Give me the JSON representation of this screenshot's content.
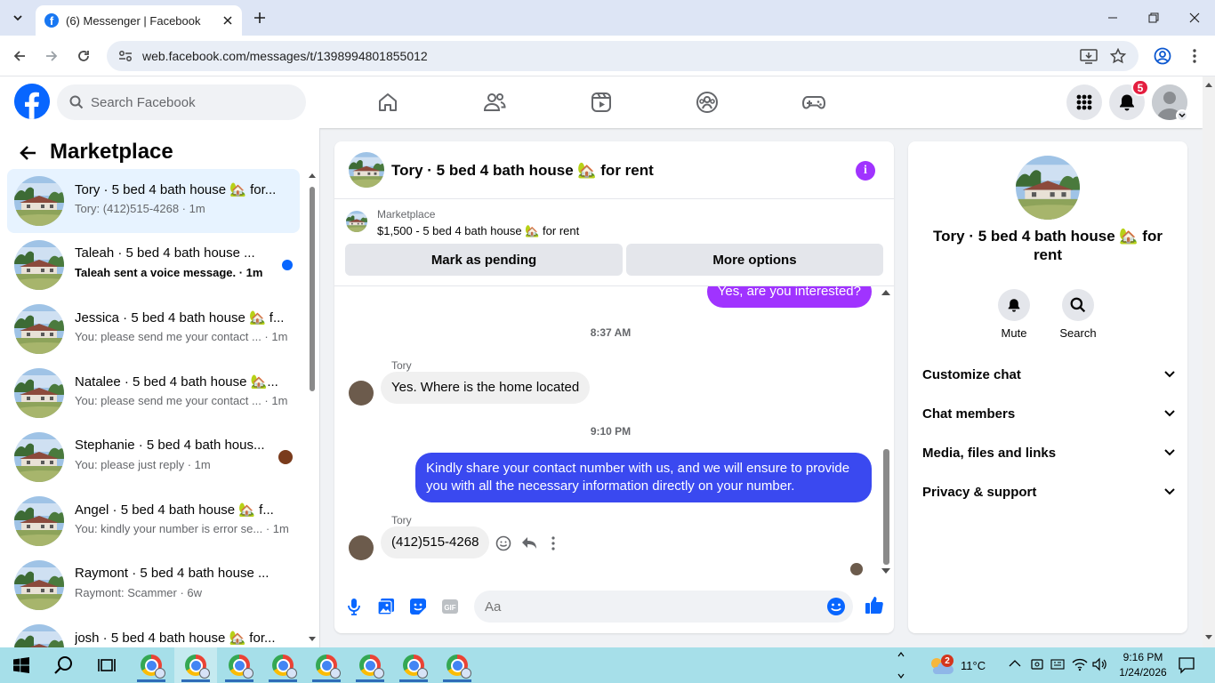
{
  "browser": {
    "tab_title": "(6) Messenger | Facebook",
    "url": "web.facebook.com/messages/t/1398994801855012"
  },
  "facebook": {
    "search_placeholder": "Search Facebook",
    "notification_count": "5",
    "brand_color": "#0866ff"
  },
  "left_panel": {
    "title": "Marketplace",
    "conversations": [
      {
        "name": "Tory · 5 bed 4 bath house 🏡 for...",
        "preview": "Tory: (412)515-4268 · 1m",
        "active": true
      },
      {
        "name": "Taleah · 5 bed 4 bath house ...",
        "preview": "Taleah sent a voice message. · 1m",
        "unread": true
      },
      {
        "name": "Jessica · 5 bed 4 bath house 🏡 f...",
        "preview": "You: please send me your contact ... · 1m"
      },
      {
        "name": "Natalee · 5 bed 4 bath house 🏡...",
        "preview": "You: please send me your contact ... · 1m"
      },
      {
        "name": "Stephanie · 5 bed 4 bath hous...",
        "preview": "You: please just reply · 1m"
      },
      {
        "name": "Angel · 5 bed 4 bath house 🏡 f...",
        "preview": "You: kindly your number is error se... · 1m"
      },
      {
        "name": "Raymont · 5 bed 4 bath house ...",
        "preview": "Raymont: Scammer · 6w"
      },
      {
        "name": "josh · 5 bed 4 bath house 🏡 for...",
        "preview": ""
      }
    ]
  },
  "chat": {
    "title": "Tory · 5 bed 4 bath house 🏡 for rent",
    "marketplace_label": "Marketplace",
    "listing": "$1,500 - 5 bed 4 bath house 🏡 for rent",
    "mark_pending": "Mark as pending",
    "more_options": "More options",
    "messages": {
      "m1": "Yes, are you interested?",
      "ts1": "8:37 AM",
      "sender1": "Tory",
      "m2": "Yes. Where is the home located",
      "ts2": "9:10 PM",
      "m3": "Kindly share your contact number with us, and we will ensure to provide you with all the necessary information directly on your number.",
      "sender2": "Tory",
      "m4": "(412)515-4268"
    },
    "input_placeholder": "Aa",
    "accent_purple": "#a033ff",
    "accent_blue": "#3a49f0"
  },
  "right_panel": {
    "name": "Tory · 5 bed 4 bath house 🏡 for rent",
    "mute": "Mute",
    "search": "Search",
    "sections": [
      "Customize chat",
      "Chat members",
      "Media, files and links",
      "Privacy & support"
    ]
  },
  "taskbar": {
    "weather_badge": "2",
    "temperature": "11°C",
    "time": "9:16 PM",
    "date": "1/24/2026"
  }
}
